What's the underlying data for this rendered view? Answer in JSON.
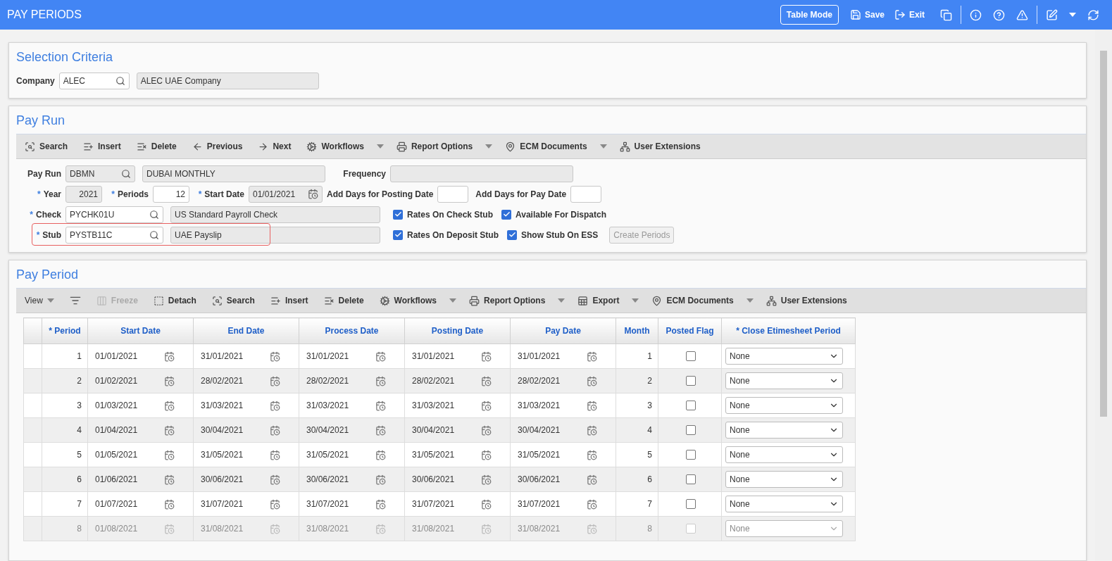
{
  "header": {
    "title": "PAY PERIODS",
    "mode_button": "Table Mode",
    "actions": [
      {
        "label": "Save"
      },
      {
        "label": "Exit"
      }
    ]
  },
  "selection_criteria": {
    "title": "Selection Criteria",
    "company": {
      "label": "Company",
      "value": "ALEC",
      "description": "ALEC UAE Company"
    }
  },
  "pay_run": {
    "title": "Pay Run",
    "toolbar": [
      {
        "label": "Search",
        "dropdown": false
      },
      {
        "label": "Insert",
        "dropdown": false
      },
      {
        "label": "Delete",
        "dropdown": false
      },
      {
        "label": "Previous",
        "dropdown": false
      },
      {
        "label": "Next",
        "dropdown": false
      },
      {
        "label": "Workflows",
        "dropdown": true
      },
      {
        "label": "Report Options",
        "dropdown": true
      },
      {
        "label": "ECM Documents",
        "dropdown": true
      },
      {
        "label": "User Extensions",
        "dropdown": false
      }
    ],
    "pay_run": {
      "label": "Pay Run",
      "value": "DBMN",
      "readonly": true,
      "description": "DUBAI MONTHLY"
    },
    "frequency": {
      "label": "Frequency"
    },
    "year": {
      "mark": "*",
      "label": "Year",
      "value": "2021",
      "readonly": true
    },
    "periods": {
      "mark": "*",
      "label": "Periods",
      "value": "12",
      "readonly": false
    },
    "start_date": {
      "mark": "*",
      "label": "Start Date",
      "value": "01/01/2021",
      "readonly": true
    },
    "posting_days": {
      "label": "Add Days for Posting Date"
    },
    "pay_days": {
      "label": "Add Days for Pay Date"
    },
    "check": {
      "mark": "*",
      "label": "Check",
      "value": "PYCHK01U",
      "readonly": false,
      "description": "US Standard Payroll Check",
      "highlighted": false
    },
    "stub": {
      "mark": "*",
      "label": "Stub",
      "value": "PYSTB11C",
      "readonly": false,
      "description": "UAE Payslip",
      "highlighted": true
    },
    "checkboxes": [
      {
        "label": "Rates On Check Stub",
        "checked": true
      },
      {
        "label": "Available For Dispatch",
        "checked": true
      },
      {
        "label": "Rates On Deposit Stub",
        "checked": true
      },
      {
        "label": "Show Stub On ESS",
        "checked": true
      }
    ],
    "create_button": {
      "label": "Create Periods",
      "disabled": true
    }
  },
  "pay_period": {
    "title": "Pay Period",
    "toolbar": [
      {
        "kind": "menu",
        "label": "View",
        "dropdown": true,
        "disabled": false
      },
      {
        "kind": "icon",
        "dropdown": false,
        "disabled": false
      },
      {
        "kind": "button",
        "label": "Freeze",
        "dropdown": false,
        "disabled": true
      },
      {
        "kind": "button",
        "label": "Detach",
        "dropdown": false,
        "disabled": false
      },
      {
        "kind": "button",
        "label": "Search",
        "dropdown": false,
        "disabled": false
      },
      {
        "kind": "button",
        "label": "Insert",
        "dropdown": false,
        "disabled": false
      },
      {
        "kind": "button",
        "label": "Delete",
        "dropdown": false,
        "disabled": false
      },
      {
        "kind": "button",
        "label": "Workflows",
        "dropdown": true,
        "disabled": false
      },
      {
        "kind": "button",
        "label": "Report Options",
        "dropdown": true,
        "disabled": false
      },
      {
        "kind": "button",
        "label": "Export",
        "dropdown": true,
        "disabled": false
      },
      {
        "kind": "button",
        "label": "ECM Documents",
        "dropdown": true,
        "disabled": false
      },
      {
        "kind": "button",
        "label": "User Extensions",
        "dropdown": false,
        "disabled": false
      }
    ],
    "columns": [
      "* Period",
      "Start Date",
      "End Date",
      "Process Date",
      "Posting Date",
      "Pay Date",
      "Month",
      "Posted Flag",
      "* Close Etimesheet Period"
    ],
    "rows": [
      {
        "period": "1",
        "start": "01/01/2021",
        "end": "31/01/2021",
        "process": "31/01/2021",
        "posting": "31/01/2021",
        "pay": "31/01/2021",
        "month": "1",
        "posted": false,
        "close": "None",
        "faded": false
      },
      {
        "period": "2",
        "start": "01/02/2021",
        "end": "28/02/2021",
        "process": "28/02/2021",
        "posting": "28/02/2021",
        "pay": "28/02/2021",
        "month": "2",
        "posted": false,
        "close": "None",
        "faded": false
      },
      {
        "period": "3",
        "start": "01/03/2021",
        "end": "31/03/2021",
        "process": "31/03/2021",
        "posting": "31/03/2021",
        "pay": "31/03/2021",
        "month": "3",
        "posted": false,
        "close": "None",
        "faded": false
      },
      {
        "period": "4",
        "start": "01/04/2021",
        "end": "30/04/2021",
        "process": "30/04/2021",
        "posting": "30/04/2021",
        "pay": "30/04/2021",
        "month": "4",
        "posted": false,
        "close": "None",
        "faded": false
      },
      {
        "period": "5",
        "start": "01/05/2021",
        "end": "31/05/2021",
        "process": "31/05/2021",
        "posting": "31/05/2021",
        "pay": "31/05/2021",
        "month": "5",
        "posted": false,
        "close": "None",
        "faded": false
      },
      {
        "period": "6",
        "start": "01/06/2021",
        "end": "30/06/2021",
        "process": "30/06/2021",
        "posting": "30/06/2021",
        "pay": "30/06/2021",
        "month": "6",
        "posted": false,
        "close": "None",
        "faded": false
      },
      {
        "period": "7",
        "start": "01/07/2021",
        "end": "31/07/2021",
        "process": "31/07/2021",
        "posting": "31/07/2021",
        "pay": "31/07/2021",
        "month": "7",
        "posted": false,
        "close": "None",
        "faded": false
      },
      {
        "period": "8",
        "start": "01/08/2021",
        "end": "31/08/2021",
        "process": "31/08/2021",
        "posting": "31/08/2021",
        "pay": "31/08/2021",
        "month": "8",
        "posted": false,
        "close": "None",
        "faded": true
      }
    ]
  }
}
